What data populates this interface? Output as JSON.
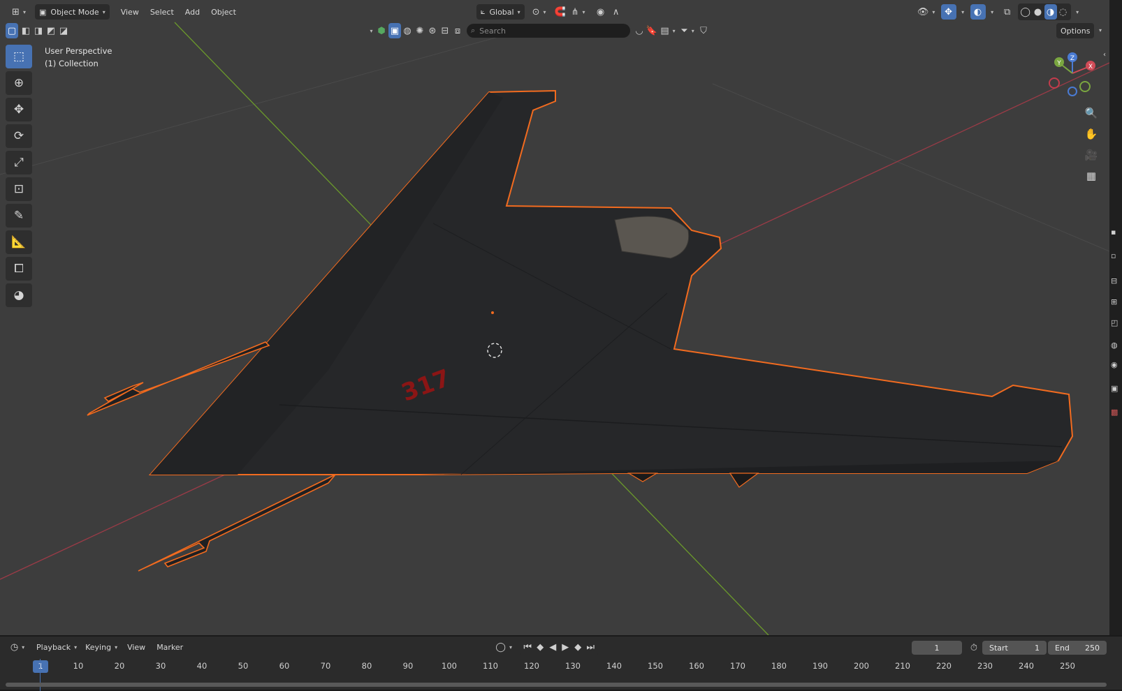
{
  "header": {
    "mode": "Object Mode",
    "menus": [
      "View",
      "Select",
      "Add",
      "Object"
    ],
    "transform_orientation": "Global",
    "options_label": "Options"
  },
  "header2": {
    "search_placeholder": "Search"
  },
  "viewport": {
    "perspective_label": "User Perspective",
    "collection_label": "(1) Collection",
    "model_text": "317",
    "gizmo_axes": [
      "X",
      "Y",
      "Z"
    ],
    "colors": {
      "background": "#3d3d3d",
      "selection_outline": "#f26b1f",
      "x_axis": "#9b3b47",
      "y_axis": "#6b9a2b",
      "accent": "#4772b3"
    }
  },
  "toolbar": {
    "tools": [
      "select-box-icon",
      "cursor-icon",
      "move-icon",
      "rotate-icon",
      "scale-icon",
      "transform-icon",
      "annotate-icon",
      "measure-icon",
      "add-cube-icon",
      "shading-icon"
    ]
  },
  "timeline": {
    "menus": [
      "Playback",
      "Keying",
      "View",
      "Marker"
    ],
    "current_frame": "1",
    "start_label": "Start",
    "start_value": "1",
    "end_label": "End",
    "end_value": "250",
    "ruler_ticks": [
      "1",
      "10",
      "20",
      "30",
      "40",
      "50",
      "60",
      "70",
      "80",
      "90",
      "100",
      "110",
      "120",
      "130",
      "140",
      "150",
      "160",
      "170",
      "180",
      "190",
      "200",
      "210",
      "220",
      "230",
      "240",
      "250"
    ]
  }
}
